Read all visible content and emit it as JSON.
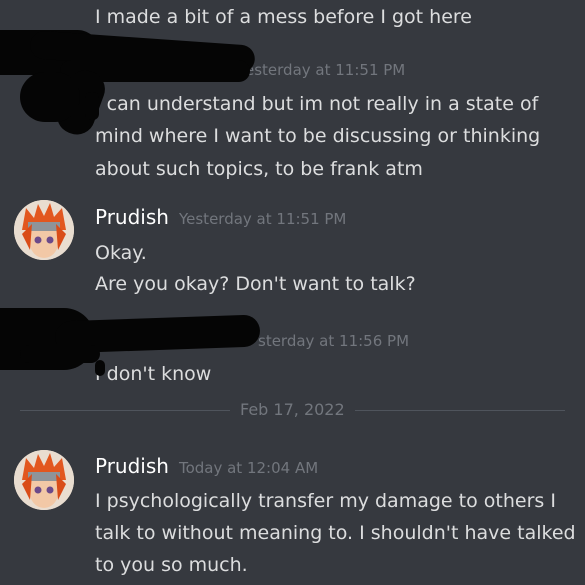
{
  "messages": {
    "m0": {
      "text": "I made a bit of a mess before I got here"
    },
    "g1": {
      "time": "esterday at 11:51 PM",
      "lines": [
        "I can understand but im not really in a state of",
        "mind where I want to be discussing or thinking",
        "about such topics, to be frank atm"
      ]
    },
    "g2": {
      "author": "Prudish",
      "time": "Yesterday at 11:51 PM",
      "lines": [
        "Okay.",
        "Are you okay? Don't want to talk?"
      ]
    },
    "g3": {
      "time": "sterday at 11:56 PM",
      "lines": [
        "I don't know"
      ]
    },
    "g4": {
      "author": "Prudish",
      "time": "Today at 12:04 AM",
      "lines": [
        "I psychologically transfer my damage to others I",
        "talk to without meaning to. I shouldn't have talked",
        "to you so much."
      ]
    }
  },
  "divider": {
    "date": "Feb 17, 2022"
  },
  "colors": {
    "background": "#36393f",
    "text": "#dcddde",
    "muted": "#72767d",
    "author": "#ffffff",
    "redaction": "#050505"
  }
}
